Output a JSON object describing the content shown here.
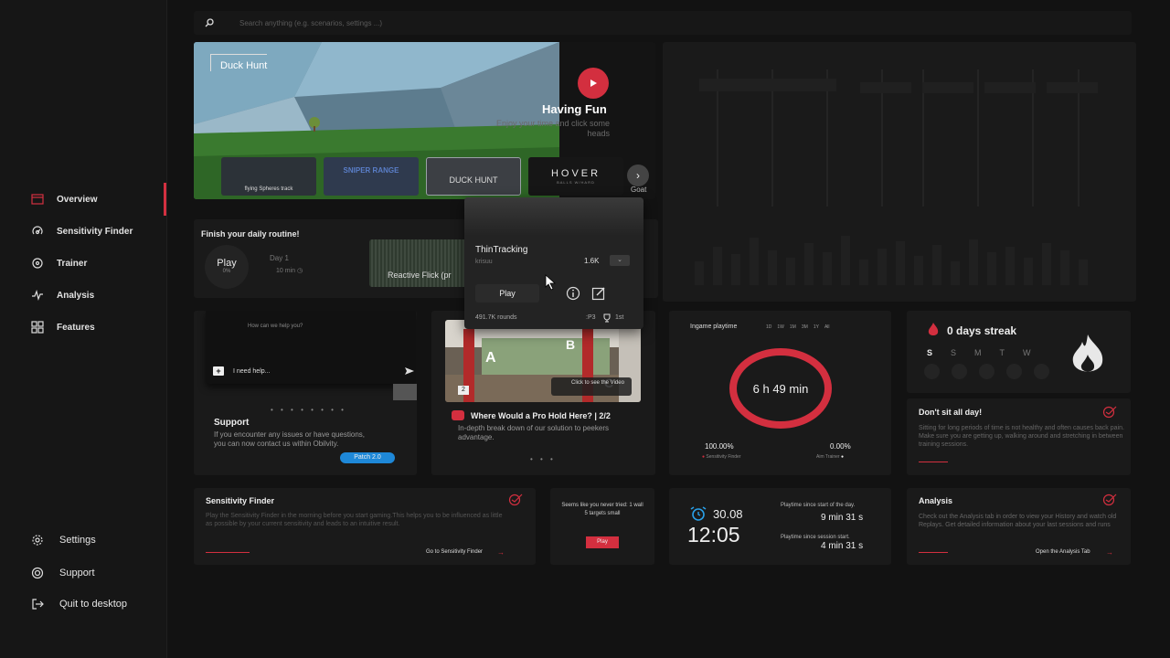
{
  "sidebar": {
    "nav": [
      {
        "label": "Overview",
        "icon": "overview-icon"
      },
      {
        "label": "Sensitivity Finder",
        "icon": "sensitivity-icon"
      },
      {
        "label": "Trainer",
        "icon": "target-icon"
      },
      {
        "label": "Analysis",
        "icon": "analysis-icon"
      },
      {
        "label": "Features",
        "icon": "features-icon"
      }
    ],
    "footer": [
      {
        "label": "Settings",
        "icon": "gear-icon"
      },
      {
        "label": "Support",
        "icon": "support-icon"
      },
      {
        "label": "Quit to desktop",
        "icon": "exit-icon"
      }
    ],
    "accent_color": "#d33040"
  },
  "search": {
    "placeholder": "Search anything (e.g. scenarios, settings ...)"
  },
  "hero": {
    "tag": "Duck Hunt",
    "heading": "Having Fun",
    "subtitle": "Enjoy your time and click some heads",
    "thumbnails": [
      {
        "caption": "flying Spheres track",
        "big": ""
      },
      {
        "caption": "",
        "big": "SNIPER RANGE"
      },
      {
        "caption": "",
        "big": "DUCK HUNT"
      },
      {
        "caption": "",
        "big": "HOVER",
        "small": "BALLS W/HARD"
      }
    ],
    "next_label": "Goat"
  },
  "routine": {
    "title": "Finish your daily routine!",
    "play": "Play",
    "percent": "0%",
    "day": "Day 1",
    "minutes": "10 min",
    "scenario": "Reactive Flick (pr"
  },
  "popup": {
    "name": "ThinTracking",
    "author": "krisuu",
    "count": "1.6K",
    "play": "Play",
    "rounds": "491.7K rounds",
    "rank": ":P3",
    "place": "1st"
  },
  "support": {
    "question": "How can we help you?",
    "input": "I need help...",
    "title": "Support",
    "description": "If you encounter any issues or have questions, you can now contact us within Obilvity.",
    "patch": "Patch 2.0",
    "dots": "• • • • • • • •"
  },
  "prohold": {
    "click_label": "Click to see the Video",
    "badge": "2",
    "title": "Where Would a Pro Hold Here? | 2/2",
    "description": "In-depth break down of our solution to peekers advantage.",
    "dots": "• • •"
  },
  "playtime": {
    "title": "Ingame playtime",
    "ranges": [
      "1D",
      "1W",
      "1M",
      "3M",
      "1Y",
      "All"
    ],
    "time": "6 h 49 min",
    "left_pct": "100.00%",
    "right_pct": "0.00%",
    "left_label": "Sensitivity Finder",
    "right_label": "Aim Trainer",
    "ring_color": "#d32f3f"
  },
  "streak": {
    "title": "0 days streak",
    "days": [
      "S",
      "S",
      "M",
      "T",
      "W"
    ]
  },
  "dontsit": {
    "title": "Don't sit all day!",
    "description": "Sitting for long periods of time is not healthy and often causes back pain. Make sure you are getting up, walking around and stretching in between training sessions."
  },
  "sensfinder": {
    "title": "Sensitivity Finder",
    "description": "Play the Sensitivity Finder in the morning before you start gaming.This helps you to be influenced as little as possible by your current sensitivity and leads to an intuitive result.",
    "link": "Go to Sensitivity Finder"
  },
  "bots": {
    "description": "Seems like you never tried: 1 wall 5 targets small",
    "button": "Play"
  },
  "clock": {
    "date": "30.08",
    "time": "12:05",
    "day_label": "Playtime since start of the day.",
    "day_value": "9 min 31 s",
    "session_label": "Playtime since session start.",
    "session_value": "4 min 31 s"
  },
  "analysis": {
    "title": "Analysis",
    "description": "Check out the Analysis tab in order to view your History and watch old Replays. Get detailed information about your last sessions and runs",
    "link": "Open the Analysis Tab"
  }
}
